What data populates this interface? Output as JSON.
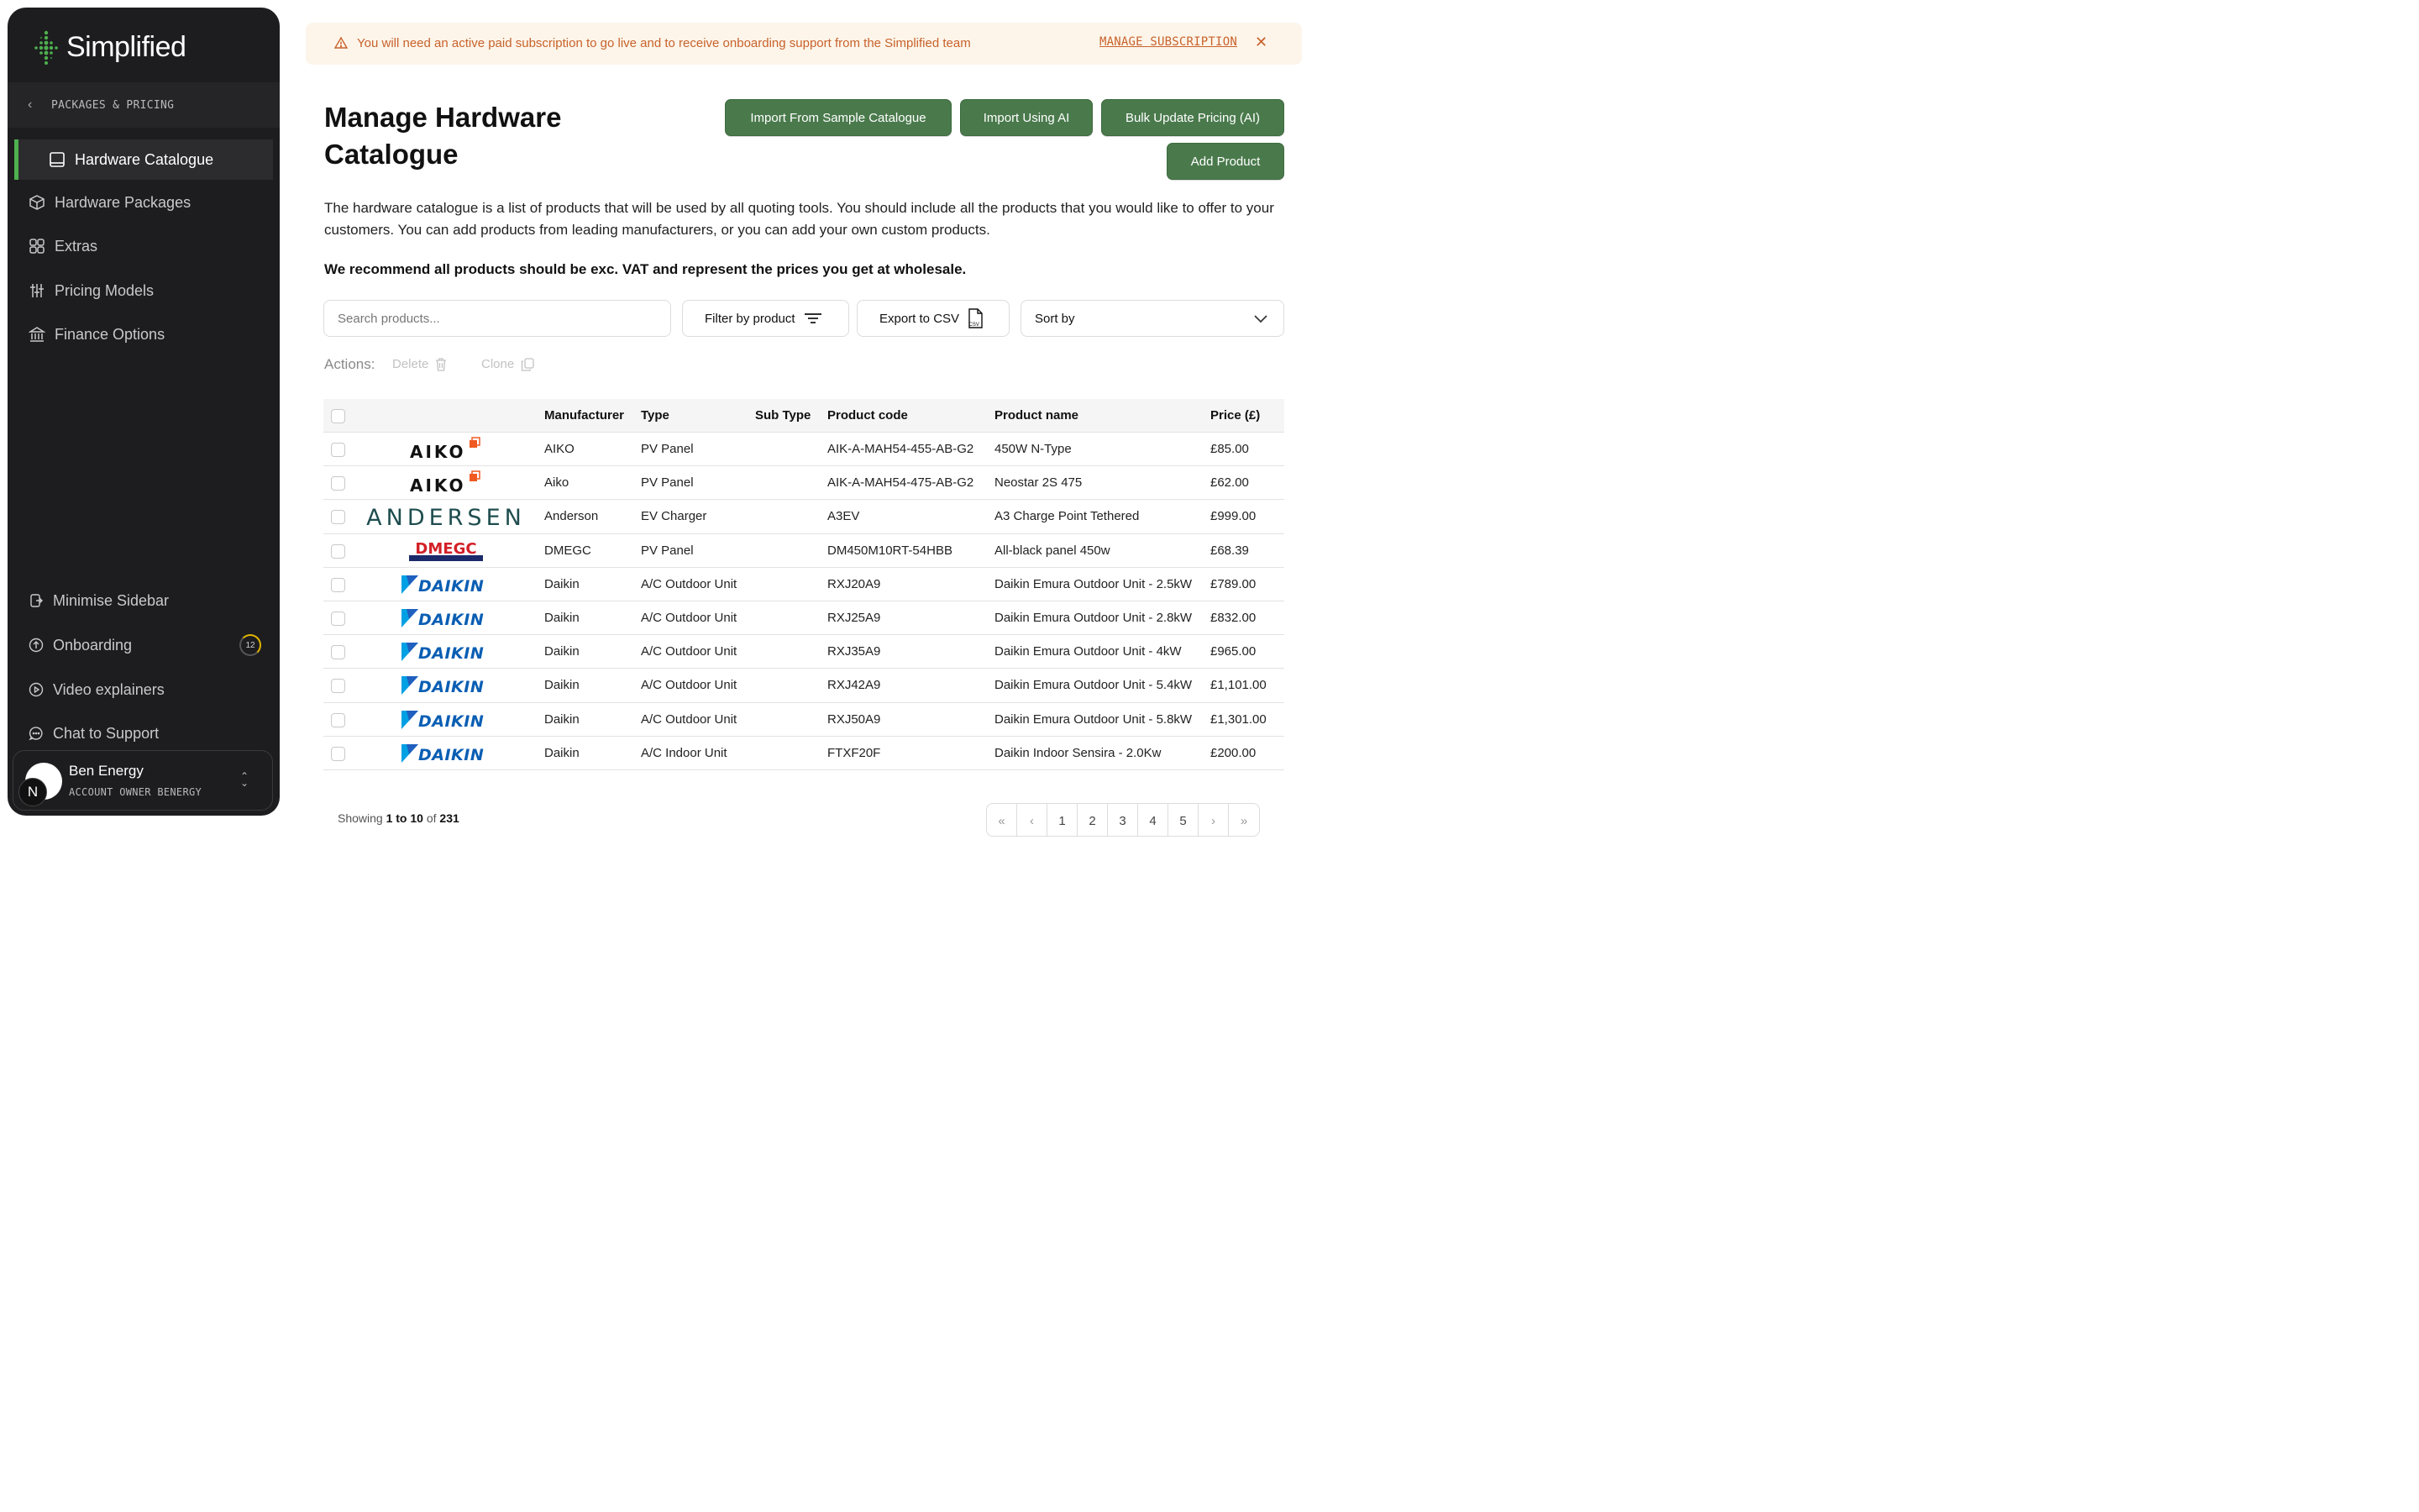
{
  "brand": {
    "name": "Simplified"
  },
  "sidebar": {
    "section_label": "PACKAGES & PRICING",
    "items": [
      {
        "label": "Hardware Catalogue",
        "icon": "book-icon",
        "active": true
      },
      {
        "label": "Hardware Packages",
        "icon": "box-icon"
      },
      {
        "label": "Extras",
        "icon": "grid-icon"
      },
      {
        "label": "Pricing Models",
        "icon": "sliders-icon"
      },
      {
        "label": "Finance Options",
        "icon": "bank-icon"
      }
    ],
    "bottom": [
      {
        "label": "Minimise Sidebar",
        "icon": "collapse-icon"
      },
      {
        "label": "Onboarding",
        "icon": "arrow-up-circle-icon",
        "badge": "12"
      },
      {
        "label": "Video explainers",
        "icon": "play-circle-icon"
      },
      {
        "label": "Chat to Support",
        "icon": "chat-icon"
      }
    ],
    "user": {
      "name": "Ben Energy",
      "role": "ACCOUNT OWNER  BENERGY",
      "initial": "N"
    }
  },
  "banner": {
    "message": "You will need an active paid subscription to go live and to receive onboarding support from the Simplified team",
    "link": "MANAGE SUBSCRIPTION",
    "close": "✕",
    "color": "#c8622b"
  },
  "header": {
    "title": "Manage Hardware Catalogue",
    "buttons": {
      "import_sample": "Import From Sample Catalogue",
      "import_ai": "Import Using AI",
      "bulk_update": "Bulk Update Pricing (AI)",
      "add_product": "Add Product"
    }
  },
  "description": "The hardware catalogue is a list of products that will be used by all quoting tools. You should include all the products that you would like to offer to your customers. You can add products from leading manufacturers, or you can add your own custom products.",
  "recommendation": "We recommend all products should be exc. VAT and represent the prices you get at wholesale.",
  "toolbar": {
    "search_placeholder": "Search products...",
    "filter_label": "Filter by product",
    "export_label": "Export to CSV",
    "sort_label": "Sort by"
  },
  "actions": {
    "label": "Actions:",
    "delete": "Delete",
    "clone": "Clone"
  },
  "table": {
    "headers": {
      "manufacturer": "Manufacturer",
      "type": "Type",
      "sub_type": "Sub Type",
      "code": "Product code",
      "name": "Product name",
      "price": "Price (£)"
    },
    "rows": [
      {
        "logo": "AIKO",
        "manufacturer": "AIKO",
        "type": "PV Panel",
        "sub_type": "",
        "code": "AIK-A-MAH54-455-AB-G2",
        "name": "450W N-Type",
        "price": "£85.00"
      },
      {
        "logo": "AIKO",
        "manufacturer": "Aiko",
        "type": "PV Panel",
        "sub_type": "",
        "code": "AIK-A-MAH54-475-AB-G2",
        "name": "Neostar 2S 475",
        "price": "£62.00"
      },
      {
        "logo": "ANDERSEN",
        "manufacturer": "Anderson",
        "type": "EV Charger",
        "sub_type": "",
        "code": "A3EV",
        "name": "A3 Charge Point Tethered",
        "price": "£999.00"
      },
      {
        "logo": "DMEGC",
        "manufacturer": "DMEGC",
        "type": "PV Panel",
        "sub_type": "",
        "code": "DM450M10RT-54HBB",
        "name": "All-black panel 450w",
        "price": "£68.39"
      },
      {
        "logo": "DAIKIN",
        "manufacturer": "Daikin",
        "type": "A/C Outdoor Unit",
        "sub_type": "",
        "code": "RXJ20A9",
        "name": "Daikin Emura Outdoor Unit - 2.5kW",
        "price": "£789.00"
      },
      {
        "logo": "DAIKIN",
        "manufacturer": "Daikin",
        "type": "A/C Outdoor Unit",
        "sub_type": "",
        "code": "RXJ25A9",
        "name": "Daikin Emura Outdoor Unit - 2.8kW",
        "price": "£832.00"
      },
      {
        "logo": "DAIKIN",
        "manufacturer": "Daikin",
        "type": "A/C Outdoor Unit",
        "sub_type": "",
        "code": "RXJ35A9",
        "name": "Daikin Emura Outdoor Unit - 4kW",
        "price": "£965.00"
      },
      {
        "logo": "DAIKIN",
        "manufacturer": "Daikin",
        "type": "A/C Outdoor Unit",
        "sub_type": "",
        "code": "RXJ42A9",
        "name": "Daikin Emura Outdoor Unit - 5.4kW",
        "price": "£1,101.00"
      },
      {
        "logo": "DAIKIN",
        "manufacturer": "Daikin",
        "type": "A/C Outdoor Unit",
        "sub_type": "",
        "code": "RXJ50A9",
        "name": "Daikin Emura Outdoor Unit - 5.8kW",
        "price": "£1,301.00"
      },
      {
        "logo": "DAIKIN",
        "manufacturer": "Daikin",
        "type": "A/C Indoor Unit",
        "sub_type": "",
        "code": "FTXF20F",
        "name": "Daikin Indoor Sensira - 2.0Kw",
        "price": "£200.00"
      }
    ]
  },
  "pagination": {
    "showing_prefix": "Showing",
    "range": "1 to 10",
    "of": "of",
    "total": "231",
    "pages": [
      "1",
      "2",
      "3",
      "4",
      "5"
    ],
    "first": "«",
    "prev": "‹",
    "next": "›",
    "last": "»"
  },
  "colors": {
    "accent": "#4a7a4c",
    "sidebar_bg": "#1d1d1f",
    "active_bar": "#4fb04f"
  }
}
